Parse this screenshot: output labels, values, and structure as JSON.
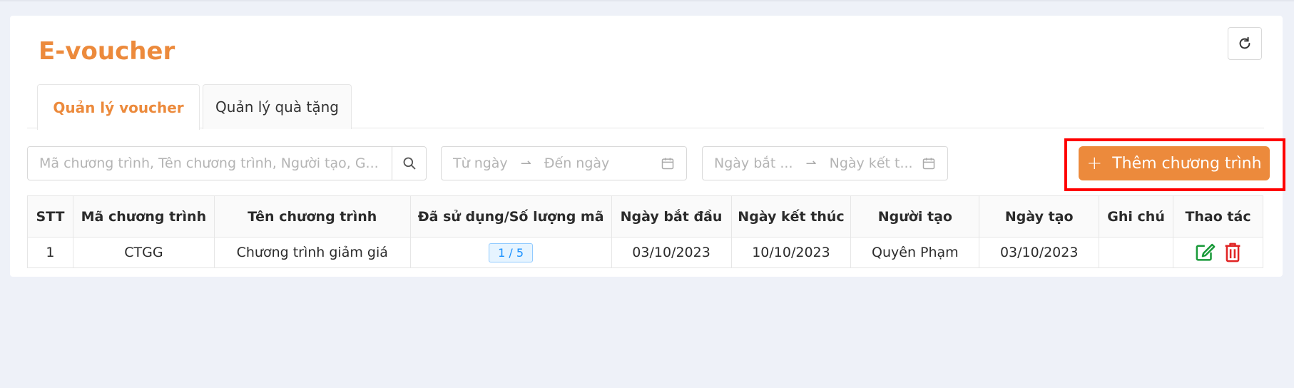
{
  "page": {
    "title": "E-voucher"
  },
  "tabs": [
    {
      "label": "Quản lý voucher",
      "active": true
    },
    {
      "label": "Quản lý quà tặng",
      "active": false
    }
  ],
  "filters": {
    "search_placeholder": "Mã chương trình, Tên chương trình, Người tạo, G...",
    "date_from_placeholder": "Từ ngày",
    "date_to_placeholder": "Đến ngày",
    "start_date_placeholder": "Ngày bắt ...",
    "end_date_placeholder": "Ngày kết t..."
  },
  "toolbar": {
    "add_label": "Thêm chương trình"
  },
  "table": {
    "headers": [
      "STT",
      "Mã chương trình",
      "Tên chương trình",
      "Đã sử dụng/Số lượng mã",
      "Ngày bắt đầu",
      "Ngày kết thúc",
      "Người tạo",
      "Ngày tạo",
      "Ghi chú",
      "Thao tác"
    ],
    "rows": [
      {
        "stt": "1",
        "code": "CTGG",
        "name": "Chương trình giảm giá",
        "usage": "1 / 5",
        "start_date": "03/10/2023",
        "end_date": "10/10/2023",
        "creator": "Quyên Phạm",
        "created_date": "03/10/2023",
        "note": ""
      }
    ]
  },
  "colors": {
    "accent": "#ec8a3c",
    "edit": "#1a9a3a",
    "delete": "#e02424",
    "highlight": "#ff0000"
  }
}
